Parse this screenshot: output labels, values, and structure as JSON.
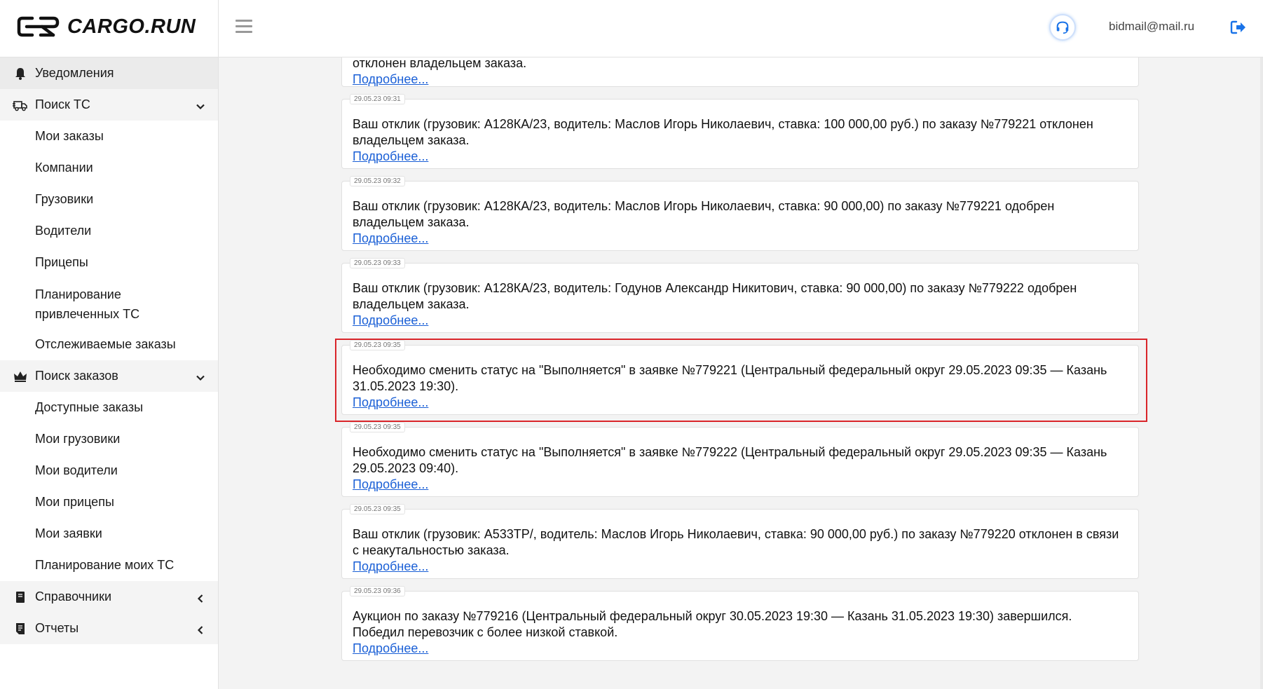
{
  "header": {
    "logo_text": "CARGO.RUN",
    "email": "bidmail@mail.ru",
    "icons": {
      "menu": "hamburger-icon",
      "support": "headset-icon",
      "logout": "logout-icon"
    },
    "accent_color": "#1a73e8"
  },
  "sidebar": {
    "items": [
      {
        "label": "Уведомления",
        "icon": "bell-icon",
        "type": "section",
        "active": true
      },
      {
        "label": "Поиск ТС",
        "icon": "truck-icon",
        "type": "section",
        "chevron": "down"
      },
      {
        "label": "Мои заказы",
        "type": "sub"
      },
      {
        "label": "Компании",
        "type": "sub"
      },
      {
        "label": "Грузовики",
        "type": "sub"
      },
      {
        "label": "Водители",
        "type": "sub"
      },
      {
        "label": "Прицепы",
        "type": "sub"
      },
      {
        "label": "Планирование привлеченных ТС",
        "type": "sub",
        "tall": true
      },
      {
        "label": "Отслеживаемые заказы",
        "type": "sub"
      },
      {
        "label": "Поиск заказов",
        "icon": "crown-icon",
        "type": "section",
        "chevron": "down"
      },
      {
        "label": "Доступные заказы",
        "type": "sub"
      },
      {
        "label": "Мои грузовики",
        "type": "sub"
      },
      {
        "label": "Мои водители",
        "type": "sub"
      },
      {
        "label": "Мои прицепы",
        "type": "sub"
      },
      {
        "label": "Мои заявки",
        "type": "sub"
      },
      {
        "label": "Планирование моих ТС",
        "type": "sub"
      },
      {
        "label": "Справочники",
        "icon": "book-icon",
        "type": "section",
        "chevron": "left"
      },
      {
        "label": "Отчеты",
        "icon": "report-icon",
        "type": "section",
        "chevron": "left"
      }
    ]
  },
  "notifications": [
    {
      "time": "",
      "text": "отклонен владельцем заказа.",
      "link": "Подробнее..."
    },
    {
      "time": "29.05.23 09:31",
      "text": "Ваш отклик (грузовик: А128КА/23, водитель: Маслов Игорь Николаевич, ставка: 100 000,00 руб.) по заказу №779221 отклонен владельцем заказа.",
      "link": "Подробнее..."
    },
    {
      "time": "29.05.23 09:32",
      "text": "Ваш отклик (грузовик: А128КА/23, водитель: Маслов Игорь Николаевич, ставка: 90 000,00) по заказу №779221 одобрен владельцем заказа.",
      "link": "Подробнее..."
    },
    {
      "time": "29.05.23 09:33",
      "text": "Ваш отклик (грузовик: А128КА/23, водитель: Годунов Александр Никитович, ставка: 90 000,00) по заказу №779222 одобрен владельцем заказа.",
      "link": "Подробнее..."
    },
    {
      "time": "29.05.23 09:35",
      "text": "Необходимо сменить статус на \"Выполняется\" в заявке №779221 (Центральный федеральный округ 29.05.2023 09:35 — Казань 31.05.2023 19:30).",
      "link": "Подробнее...",
      "highlighted": true
    },
    {
      "time": "29.05.23 09:35",
      "text": "Необходимо сменить статус на \"Выполняется\" в заявке №779222 (Центральный федеральный округ 29.05.2023 09:35 — Казань 29.05.2023 09:40).",
      "link": "Подробнее..."
    },
    {
      "time": "29.05.23 09:35",
      "text": "Ваш отклик (грузовик: А533ТР/, водитель: Маслов Игорь Николаевич, ставка: 90 000,00 руб.) по заказу №779220 отклонен в связи с неакутальностью заказа.",
      "link": "Подробнее..."
    },
    {
      "time": "29.05.23 09:36",
      "text": "Аукцион по заказу №779216 (Центральный федеральный округ 30.05.2023 19:30 — Казань 31.05.2023 19:30) завершился. Победил перевозчик с более низкой ставкой.",
      "link": "Подробнее..."
    }
  ],
  "highlight_color": "#d9252a"
}
